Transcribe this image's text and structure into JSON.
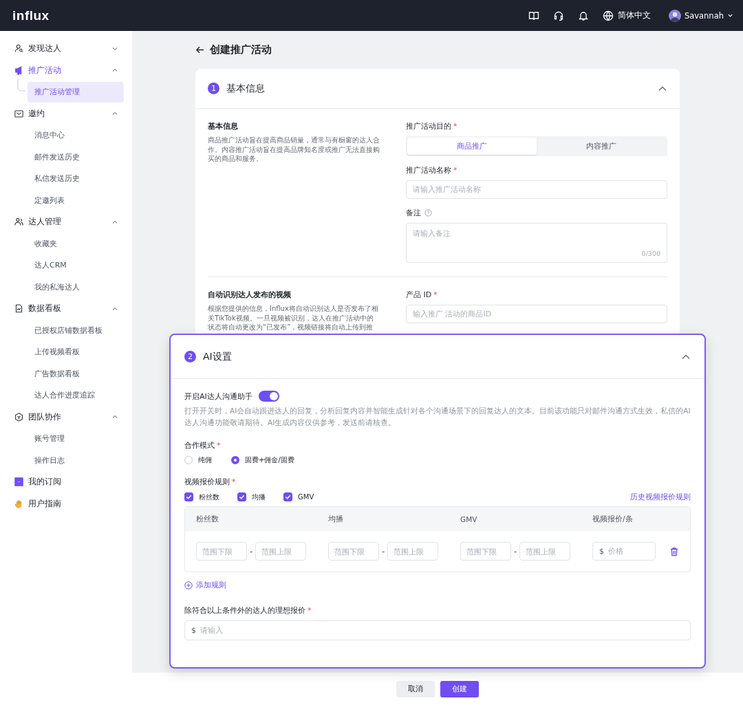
{
  "topbar": {
    "logo": "influx",
    "language": "简体中文",
    "user": "Savannah"
  },
  "sidebar": {
    "items": [
      {
        "label": "发现达人",
        "kind": "group",
        "expanded": false,
        "active": false
      },
      {
        "label": "推广活动",
        "kind": "group",
        "expanded": true,
        "active": true,
        "children": [
          {
            "label": "推广活动管理",
            "selected": true
          }
        ]
      },
      {
        "label": "邀约",
        "kind": "group",
        "expanded": true,
        "active": false,
        "children": [
          {
            "label": "消息中心",
            "selected": false
          },
          {
            "label": "邮件发送历史",
            "selected": false
          },
          {
            "label": "私信发送历史",
            "selected": false
          },
          {
            "label": "定邀列表",
            "selected": false
          }
        ]
      },
      {
        "label": "达人管理",
        "kind": "group",
        "expanded": true,
        "active": false,
        "children": [
          {
            "label": "收藏夹",
            "selected": false
          },
          {
            "label": "达人CRM",
            "selected": false
          },
          {
            "label": "我的私海达人",
            "selected": false
          }
        ]
      },
      {
        "label": "数据看板",
        "kind": "group",
        "expanded": true,
        "active": false,
        "children": [
          {
            "label": "已授权店铺数据看板",
            "selected": false
          },
          {
            "label": "上传视频看板",
            "selected": false
          },
          {
            "label": "广告数据看板",
            "selected": false
          },
          {
            "label": "达人合作进度追踪",
            "selected": false
          }
        ]
      },
      {
        "label": "团队协作",
        "kind": "group",
        "expanded": true,
        "active": false,
        "children": [
          {
            "label": "账号管理",
            "selected": false
          },
          {
            "label": "操作日志",
            "selected": false
          }
        ]
      },
      {
        "label": "我的订阅",
        "kind": "link"
      },
      {
        "label": "用户指南",
        "kind": "link"
      }
    ]
  },
  "page": {
    "title": "创建推广活动"
  },
  "basic_card": {
    "step": "1",
    "title": "基本信息",
    "sections": [
      {
        "title": "基本信息",
        "description": "商品推广活动旨在提高商品销量，通常与有橱窗的达人合作。内容推广活动旨在提高品牌知名度或推广无法直接购买的商品和服务。",
        "fields": [
          {
            "kind": "segmented",
            "label": "推广活动目的",
            "required_mark": "*",
            "options": [
              {
                "label": "商品推广",
                "selected": true
              },
              {
                "label": "内容推广",
                "selected": false
              }
            ]
          },
          {
            "kind": "input",
            "label": "推广活动名称",
            "required_mark": "*",
            "placeholder": "请输入推广活动名称"
          },
          {
            "kind": "textarea",
            "label": "备注",
            "help": true,
            "placeholder": "请输入备注",
            "counter": "0/300"
          }
        ]
      },
      {
        "title": "自动识别达人发布的视频",
        "description": "根据您提供的信息，Influx将自动识别达人是否发布了相关TikTok视频。一旦视频被识别，达人在推广活动中的状态将自动更改为“已发布”，视频链接将自动上传到推",
        "fields": [
          {
            "kind": "input",
            "label": "产品 ID",
            "required_mark": "*",
            "placeholder": "输入推广 活动的商品ID"
          }
        ]
      }
    ]
  },
  "ai_card": {
    "step": "2",
    "title": "AI设置",
    "toggle": {
      "label": "开启AI达人沟通助手",
      "on": true
    },
    "description": "打开开关时，AI会自动跟进达人的回复，分析回复内容并智能生成针对各个沟通场景下的回复达人的文本。目前该功能只对邮件沟通方式生效，私信的AI达人沟通功能敬请期待。AI生成内容仅供参考，发送前请核查。",
    "cooperation": {
      "label": "合作模式",
      "required_mark": "*",
      "options": [
        {
          "label": "纯佣",
          "selected": false
        },
        {
          "label": "固费+佣金/固费",
          "selected": true
        }
      ]
    },
    "pricing": {
      "label": "视频报价规则",
      "required_mark": "*",
      "link": "历史视频报价规则",
      "checks": [
        {
          "label": "粉丝数",
          "checked": true
        },
        {
          "label": "均播",
          "checked": true
        },
        {
          "label": "GMV",
          "checked": true
        }
      ],
      "columns": [
        "粉丝数",
        "均播",
        "GMV",
        "视频报价/条"
      ],
      "rows": [
        {
          "cells": [
            {
              "kind": "range",
              "min_placeholder": "范围下限",
              "separator": "-",
              "max_placeholder": "范围上限"
            },
            {
              "kind": "range",
              "min_placeholder": "范围下限",
              "separator": "-",
              "max_placeholder": "范围上限"
            },
            {
              "kind": "range",
              "min_placeholder": "范围下限",
              "separator": "-",
              "max_placeholder": "范围上限"
            },
            {
              "kind": "price",
              "currency": "$",
              "placeholder": "价格"
            }
          ]
        }
      ],
      "add_rule": "添加规则"
    },
    "ideal": {
      "label": "除符合以上条件外的达人的理想报价",
      "required_mark": "*",
      "currency": "$",
      "placeholder": "请输入"
    }
  },
  "footer": {
    "cancel": "取消",
    "create": "创建"
  }
}
